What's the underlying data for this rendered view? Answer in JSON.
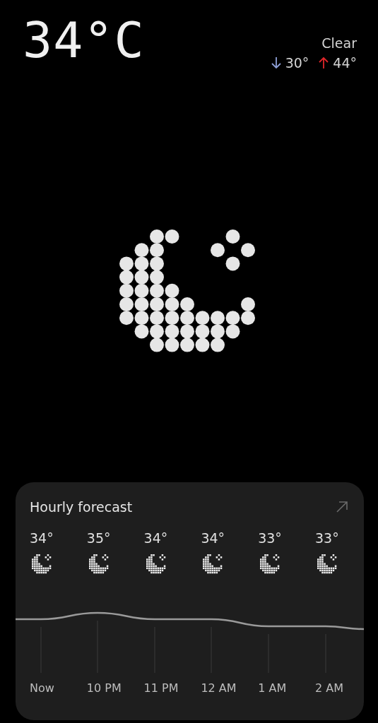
{
  "current": {
    "temperature": "34°C",
    "condition": "Clear",
    "low": "30°",
    "high": "44°"
  },
  "hourly": {
    "title": "Hourly forecast",
    "hours": [
      {
        "temp": "34°",
        "time": "Now"
      },
      {
        "temp": "35°",
        "time": "10 PM"
      },
      {
        "temp": "34°",
        "time": "11 PM"
      },
      {
        "temp": "34°",
        "time": "12 AM"
      },
      {
        "temp": "33°",
        "time": "1 AM"
      },
      {
        "temp": "33°",
        "time": "2 AM"
      }
    ]
  }
}
